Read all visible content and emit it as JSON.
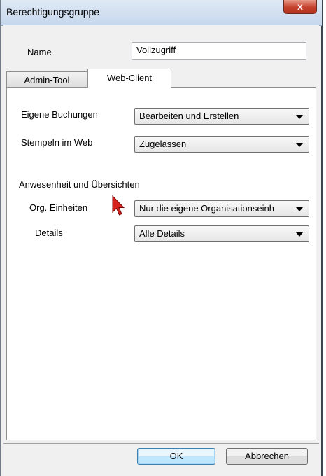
{
  "window": {
    "title": "Berechtigungsgruppe",
    "close_glyph": "x"
  },
  "name_field": {
    "label": "Name",
    "value": "Vollzugriff"
  },
  "tabs": [
    {
      "label": "Admin-Tool",
      "active": false
    },
    {
      "label": "Web-Client",
      "active": true
    }
  ],
  "panel": {
    "eigene_buchungen": {
      "label": "Eigene Buchungen",
      "value": "Bearbeiten und Erstellen"
    },
    "stempeln_im_web": {
      "label": "Stempeln im Web",
      "value": "Zugelassen"
    },
    "section_title": "Anwesenheit und Übersichten",
    "org_einheiten": {
      "label": "Org. Einheiten",
      "value": "Nur die eigene Organisationseinh"
    },
    "details": {
      "label": "Details",
      "value": "Alle Details"
    }
  },
  "buttons": {
    "ok": "OK",
    "cancel": "Abbrechen"
  },
  "colors": {
    "close_button": "#c4412c",
    "cursor": "#d8201c",
    "titlebar": "#c6d7ec"
  },
  "icons": {
    "cursor": "mouse-pointer-icon"
  }
}
